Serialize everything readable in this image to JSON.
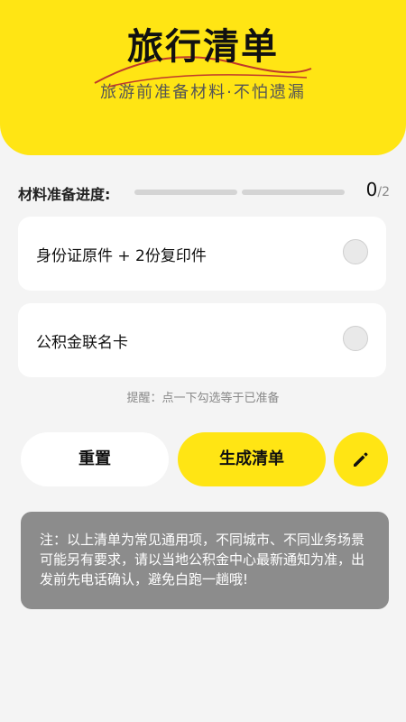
{
  "header": {
    "title": "旅行清单",
    "subtitle": "旅游前准备材料·不怕遗漏",
    "color": "#ffe514"
  },
  "progress": {
    "label": "材料准备进度:",
    "done": "0",
    "total": "/2",
    "fraction": 0
  },
  "items": [
    {
      "label": "身份证原件 + 2份复印件",
      "checked": false
    },
    {
      "label": "公积金联名卡",
      "checked": false
    }
  ],
  "tip": "提醒：点一下勾选等于已准备",
  "actions": {
    "reset_label": "重置",
    "generate_label": "生成清单",
    "edit_icon": "pencil-icon"
  },
  "note": "注：以上清单为常见通用项，不同城市、不同业务场景可能另有要求，请以当地公积金中心最新通知为准，出发前先电话确认，避免白跑一趟哦!"
}
